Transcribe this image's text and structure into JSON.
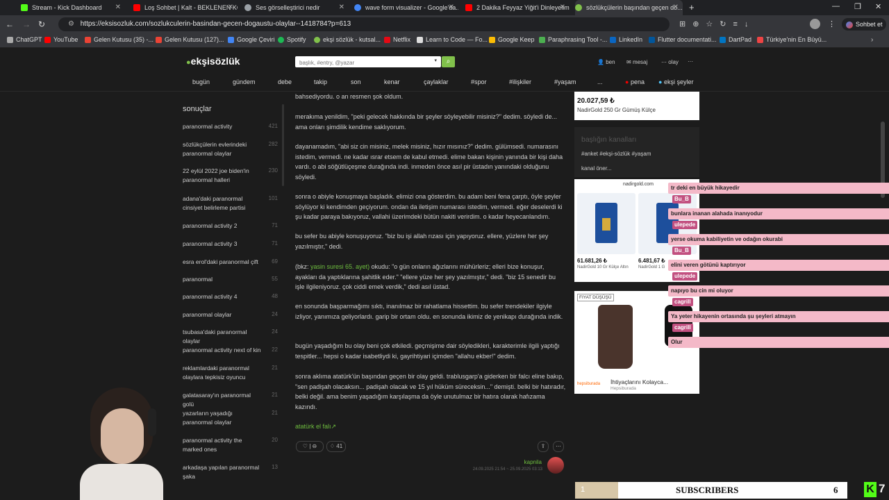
{
  "tabs": [
    {
      "label": "Stream - Kick Dashboard",
      "color": "#53fc18"
    },
    {
      "label": "Loş Sohbet | Kalt - BEKLENEN KO...",
      "color": "#ff0000"
    },
    {
      "label": "Ses görselleştirici nedir",
      "color": "#9aa0a6"
    },
    {
      "label": "wave form visualizer - Google'da...",
      "color": "#4285f4"
    },
    {
      "label": "2 Dakika Feyyaz Yiğit'i Dinleyelim",
      "color": "#ff0000"
    },
    {
      "label": "sözlükçülerin başından geçen do...",
      "color": "#81c14b"
    }
  ],
  "url": "https://eksisozluk.com/sozlukculerin-basindan-gecen-dogaustu-olaylar--1418784?p=613",
  "profile": "Sohbet et",
  "bookmarks": [
    "ChatGPT",
    "YouTube",
    "Gelen Kutusu (35) -...",
    "Gelen Kutusu (127)...",
    "Google Çeviri",
    "Spotify",
    "ekşi sözlük - kutsal...",
    "Netflix",
    "Learn to Code — Fo...",
    "Google Keep",
    "Paraphrasing Tool -...",
    "LinkedIn",
    "Flutter documentati...",
    "DartPad",
    "Türkiye'nin En Büyü..."
  ],
  "site": {
    "logo": "ekşisözlük",
    "search_placeholder": "başlık, #entry, @yazar",
    "user_links": [
      "ben",
      "mesaj",
      "olay"
    ],
    "more": "···",
    "nav": [
      "bugün",
      "gündem",
      "debe",
      "takip",
      "son",
      "kenar",
      "çaylaklar",
      "#spor",
      "#ilişkiler",
      "#yaşam",
      "..."
    ],
    "pena": "pena",
    "eksi_seyler": "ekşi şeyler"
  },
  "sidebar": {
    "title": "sonuçlar",
    "items": [
      {
        "label": "paranormal activity",
        "count": "421"
      },
      {
        "label": "sözlükçülerin evlerindeki paranormal olaylar",
        "count": "282"
      },
      {
        "label": "22 eylül 2022 joe biden'in paranormal halleri",
        "count": "230"
      },
      {
        "label": "adana'daki paranormal cinsiyet belirleme partisi",
        "count": "101"
      },
      {
        "label": "paranormal activity 2",
        "count": "71"
      },
      {
        "label": "paranormal activity 3",
        "count": "71"
      },
      {
        "label": "esra erol'daki paranormal çift",
        "count": "69"
      },
      {
        "label": "paranormal",
        "count": "55"
      },
      {
        "label": "paranormal activity 4",
        "count": "48"
      },
      {
        "label": "paranormal olaylar",
        "count": "24"
      },
      {
        "label": "tsubasa'daki paranormal olaylar",
        "count": "24"
      },
      {
        "label": "paranormal activity next of kin",
        "count": "22"
      },
      {
        "label": "reklamlardaki paranormal olaylara tepkisiz oyuncu",
        "count": "21"
      },
      {
        "label": "galatasaray'ın paranormal golü",
        "count": "21"
      },
      {
        "label": "yazarların yaşadığı paranormal olaylar",
        "count": "21"
      },
      {
        "label": "paranormal activity the marked ones",
        "count": "20"
      },
      {
        "label": "arkadaşa yapılan paranormal şaka",
        "count": "13"
      }
    ]
  },
  "entry": {
    "paragraphs": [
      "bahsediyordu. o an resmen şok oldum.",
      "merakıma yenildim, \"peki gelecek hakkında bir şeyler söyleyebilir misiniz?\" dedim. söyledi de... ama onları şimdilik kendime saklıyorum.",
      "dayanamadım, \"abi siz cin misiniz, melek misiniz, hızır mısınız?\" dedim. gülümsedi. numarasını istedim, vermedi. ne kadar ısrar etsem de kabul etmedi. elime bakan kişinin yanında bir kişi daha vardı. o abi söğütlüçeşme durağında indi. inmeden önce asıl pir üstadın yanındaki olduğunu söyledi.",
      "sonra o abiyle konuşmaya başladık. elimizi ona gösterdim. bu adam beni fena çarptı, öyle şeyler söylüyor ki kendimden geçiyorum. ondan da iletişim numarası istedim, vermedi. eğer deselerdi ki şu kadar paraya bakıyoruz, vallahi üzerimdeki bütün nakiti verirdim. o kadar heyecanlandım.",
      "bu sefer bu abiyle konuşuyoruz. \"biz bu işi allah rızası için yapıyoruz. ellere, yüzlere her şey yazılmıştır,\" dedi.",
      "okudu: \"o gün onların ağızlarını mühürleriz; elleri bize konuşur, ayakları da yaptıklarına şahitlik eder.\" \"ellere yüze her şey yazılmıştır,\" dedi. \"biz 15 senedir bu işle ilgileniyoruz. çok ciddi emek verdik,\" dedi asıl üstad.",
      "en sonunda başparmağımı sıktı, inanılmaz bir rahatlama hissettim. bu sefer trendekiler ilgiyle izliyor, yanımıza geliyorlardı. garip bir ortam oldu. en sonunda ikimiz de yenikapı durağında indik.",
      "bugün yaşadığım bu olay beni çok etkiledi. geçmişime dair söyledikleri, karakterimle ilgili yaptığı tespitler... hepsi o kadar isabetliydi ki, gayrihtiyari içimden \"allahu ekber!\" dedim.",
      "sonra aklıma atatürk'ün başından geçen bir olay geldi. trablusgarp'a giderken bir falcı eline bakıp, \"sen padişah olacaksın... padişah olacak ve 15 yıl hüküm süreceksin...\" demişti. belki bir hatıradır, belki değil. ama benim yaşadığım karşılaşma da öyle unutulmaz bir hatıra olarak hafızama kazındı."
    ],
    "bkz_prefix": "(bkz:",
    "bkz_link": "yasin suresi 65. ayet)",
    "link": "atatürk el falı",
    "fav_count": "41",
    "author": "kapnila",
    "date": "24.09.2025 21:54 ~ 25.09.2025 03:13"
  },
  "right": {
    "price_top": "20.027,59 ₺",
    "product_top": "NadirGold 250 Gr Gümüş Külçe",
    "channels_title": "başlığın kanalları",
    "channels": "#anket #ekşi-sözlük #yaşam",
    "channels_more": "kanal öner...",
    "ad_domain": "nadirgold.com",
    "ad_price1": "61.681,26 ₺",
    "ad_name1": "NadirGold 10 Gr Külçe Altın",
    "ad_price2": "6.481,67 ₺",
    "ad_name2": "NadirGold 1 G",
    "ad2_badge": "FIYAT DÜŞÜŞÜ",
    "ad2_brand": "hepsiburada",
    "ad2_title": "İhtiyaçlarını Kolayca...",
    "ad2_sub": "Hepsiburada"
  },
  "chat": [
    {
      "type": "msg",
      "text": "tr deki en büyük hikayedir"
    },
    {
      "type": "nick",
      "text": "Bu_B"
    },
    {
      "type": "msg",
      "text": "bunlara inanan alahada inanıyodur"
    },
    {
      "type": "nick",
      "text": "ulepede"
    },
    {
      "type": "msg",
      "text": "yerse okuma kabiliyetin ve odağın okurabi"
    },
    {
      "type": "nick",
      "text": "Bu_B"
    },
    {
      "type": "msg",
      "text": "elini veren götünü kaptırıyor"
    },
    {
      "type": "nick",
      "text": "ulepede"
    },
    {
      "type": "msg",
      "text": "napıyo bu cin mi oluyor"
    },
    {
      "type": "nick",
      "text": "cagrill"
    },
    {
      "type": "msg",
      "text": "Ya yeter hikayenin ortasında şu şeyleri atmayın"
    },
    {
      "type": "nick",
      "text": "cagrill"
    },
    {
      "type": "msg",
      "text": "Olur"
    }
  ],
  "overlay": {
    "subscribers_label": "SUBSCRIBERS",
    "subscribers_value": "6",
    "kick_count": "7",
    "goal_value": "1"
  },
  "colors": {
    "accent": "#81c14b",
    "chat_bg": "#f4b9c8",
    "nick_bg": "#c25080"
  }
}
